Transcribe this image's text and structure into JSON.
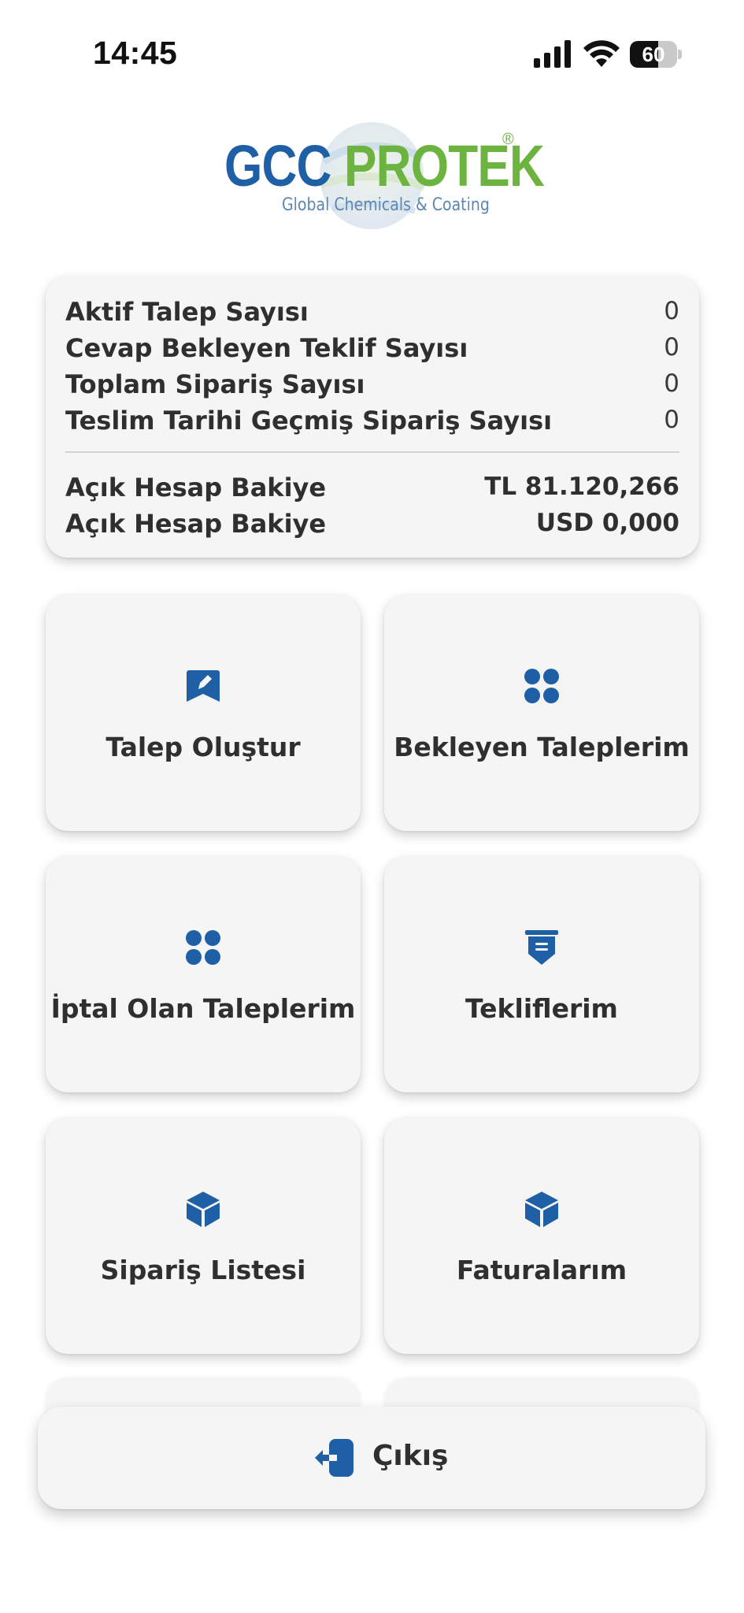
{
  "status_bar": {
    "time": "14:45",
    "battery_level": "60",
    "icons": [
      "cellular-signal-icon",
      "wifi-icon",
      "battery-icon"
    ]
  },
  "logo": {
    "brand_part1": "GCC",
    "brand_part2": "PROTEK",
    "registered": "®",
    "tagline": "Global Chemicals & Coating"
  },
  "summary": {
    "rows": [
      {
        "label": "Aktif Talep Sayısı",
        "value": "0"
      },
      {
        "label": "Cevap Bekleyen Teklif Sayısı",
        "value": "0"
      },
      {
        "label": "Toplam Sipariş Sayısı",
        "value": "0"
      },
      {
        "label": "Teslim Tarihi Geçmiş Sipariş Sayısı",
        "value": "0"
      }
    ],
    "balances": [
      {
        "label": "Açık Hesap Bakiye",
        "value": "TL 81.120,266"
      },
      {
        "label": "Açık Hesap Bakiye",
        "value": "USD 0,000"
      }
    ]
  },
  "menu": {
    "tiles": [
      {
        "label": "Talep Oluştur",
        "icon": "create-request-icon"
      },
      {
        "label": "Bekleyen Taleplerim",
        "icon": "grid-icon"
      },
      {
        "label": "İptal Olan Taleplerim",
        "icon": "grid-icon"
      },
      {
        "label": "Tekliflerim",
        "icon": "offer-badge-icon"
      },
      {
        "label": "Sipariş Listesi",
        "icon": "cube-icon"
      },
      {
        "label": "Faturalarım",
        "icon": "cube-icon"
      }
    ]
  },
  "logout": {
    "label": "Çıkış",
    "icon": "logout-icon"
  },
  "colors": {
    "brand_blue": "#1f5fa6",
    "brand_green": "#6cb33f",
    "card_bg": "#f5f5f5",
    "text": "#2f2f2f"
  }
}
